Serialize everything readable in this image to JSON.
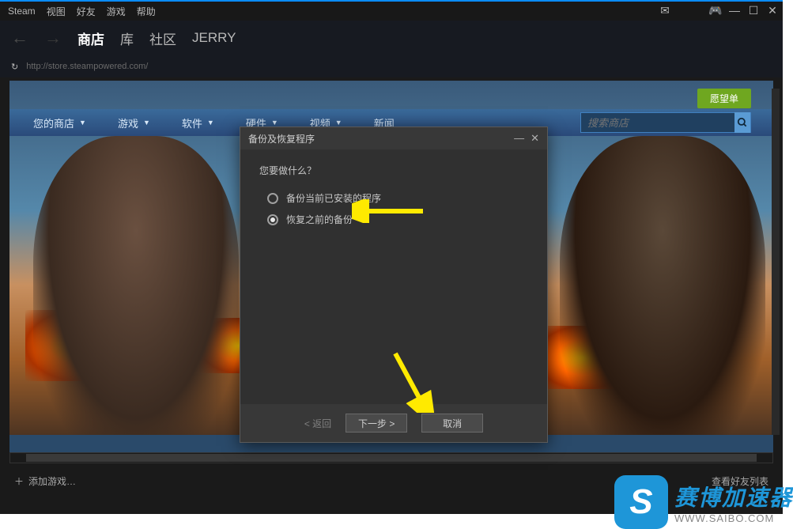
{
  "menubar": {
    "items": [
      "Steam",
      "视图",
      "好友",
      "游戏",
      "帮助"
    ]
  },
  "navbar": {
    "back": "←",
    "forward": "→",
    "links": [
      {
        "label": "商店",
        "active": true
      },
      {
        "label": "库",
        "active": false
      },
      {
        "label": "社区",
        "active": false
      },
      {
        "label": "JERRY",
        "active": false
      }
    ]
  },
  "urlbar": {
    "url": "http://store.steampowered.com/"
  },
  "store": {
    "wishlist": "愿望单",
    "nav_items": [
      {
        "label": "您的商店",
        "dropdown": true
      },
      {
        "label": "游戏",
        "dropdown": true
      },
      {
        "label": "软件",
        "dropdown": true
      },
      {
        "label": "硬件",
        "dropdown": true
      },
      {
        "label": "视频",
        "dropdown": true
      },
      {
        "label": "新闻",
        "dropdown": false
      }
    ],
    "search_placeholder": "搜索商店"
  },
  "dialog": {
    "title": "备份及恢复程序",
    "prompt": "您要做什么？",
    "options": [
      {
        "label": "备份当前已安装的程序",
        "checked": false
      },
      {
        "label": "恢复之前的备份",
        "checked": true
      }
    ],
    "back": "< 返回",
    "next": "下一步 >",
    "cancel": "取消"
  },
  "bottombar": {
    "add_game": "添加游戏…",
    "friends": "查看好友列表"
  },
  "watermark": {
    "logo": "S",
    "title": "赛博加速器",
    "url": "WWW.SAIBO.COM"
  }
}
